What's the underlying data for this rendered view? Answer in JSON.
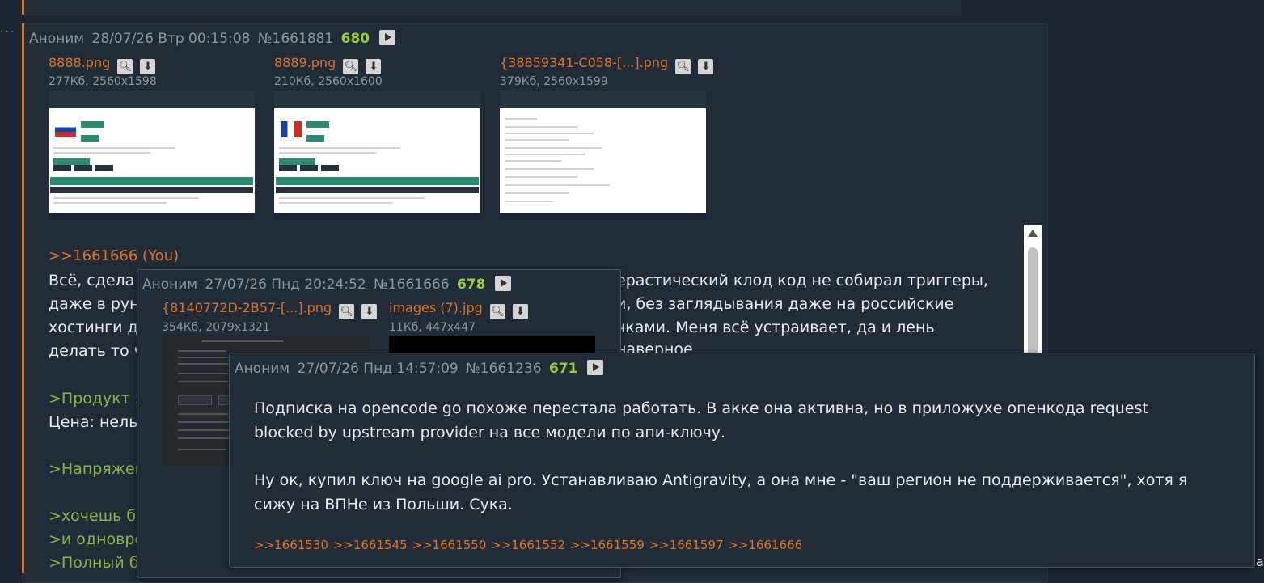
{
  "nav": {
    "dots_label": "⋮"
  },
  "posts": {
    "main": {
      "author": "Аноним",
      "date": "28/07/26 Втр 00:15:08",
      "number": "№1661881",
      "count": "680",
      "files": [
        {
          "name": "8888.png",
          "meta": "277Кб, 2560x1598"
        },
        {
          "name": "8889.png",
          "meta": "210Кб, 2560x1600"
        },
        {
          "name": "{38859341-C058-[...].png",
          "meta": "379Кб, 2560x1599"
        }
      ],
      "reply": ">>1661666 (You)",
      "lines": [
        "Всё, сдела",
        "даже в рун",
        "хостинги д",
        "делать то ч"
      ],
      "lines_right": [
        "ерастический клод код не собирал триггеры,",
        "и, без заглядывания даже на российские",
        "чками. Меня всё устраивает, да и лень",
        "наверное"
      ],
      "green1": ">Продукт з",
      "price": "Цена: нель",
      "green2": ">Напряжен",
      "green3": ">хочешь бе",
      "green4": ">и одновре",
      "green5": ">Полный б"
    },
    "popup1": {
      "author": "Аноним",
      "date": "27/07/26 Пнд 20:24:52",
      "number": "№1661666",
      "count": "678",
      "files": [
        {
          "name": "{8140772D-2B57-[...].png",
          "meta": "354Кб, 2079x1321"
        },
        {
          "name": "images (7).jpg",
          "meta": "11Кб, 447x447"
        }
      ]
    },
    "popup2": {
      "author": "Аноним",
      "date": "27/07/26 Пнд 14:57:09",
      "number": "№1661236",
      "count": "671",
      "body": [
        "Подписка на opencode go похоже перестала работать. В акке она активна, но в приложухе опенкода request",
        "blocked by upstream provider на все модели по апи-ключу.",
        "Ну ок, купил ключ на google ai pro. Устанавливаю Antigravity, а она мне - \"ваш регион не поддерживается\", хотя я",
        "сижу на ВПНе из Польши. Сука."
      ],
      "links": ">>1661530 >>1661545 >>1661550 >>1661552 >>1661559 >>1661597 >>1661666"
    }
  },
  "edge_text": "ан",
  "colors": {
    "accent": "#d9742b",
    "greentext": "#89b64a",
    "count": "#9acd32",
    "bg": "#1d2530"
  }
}
